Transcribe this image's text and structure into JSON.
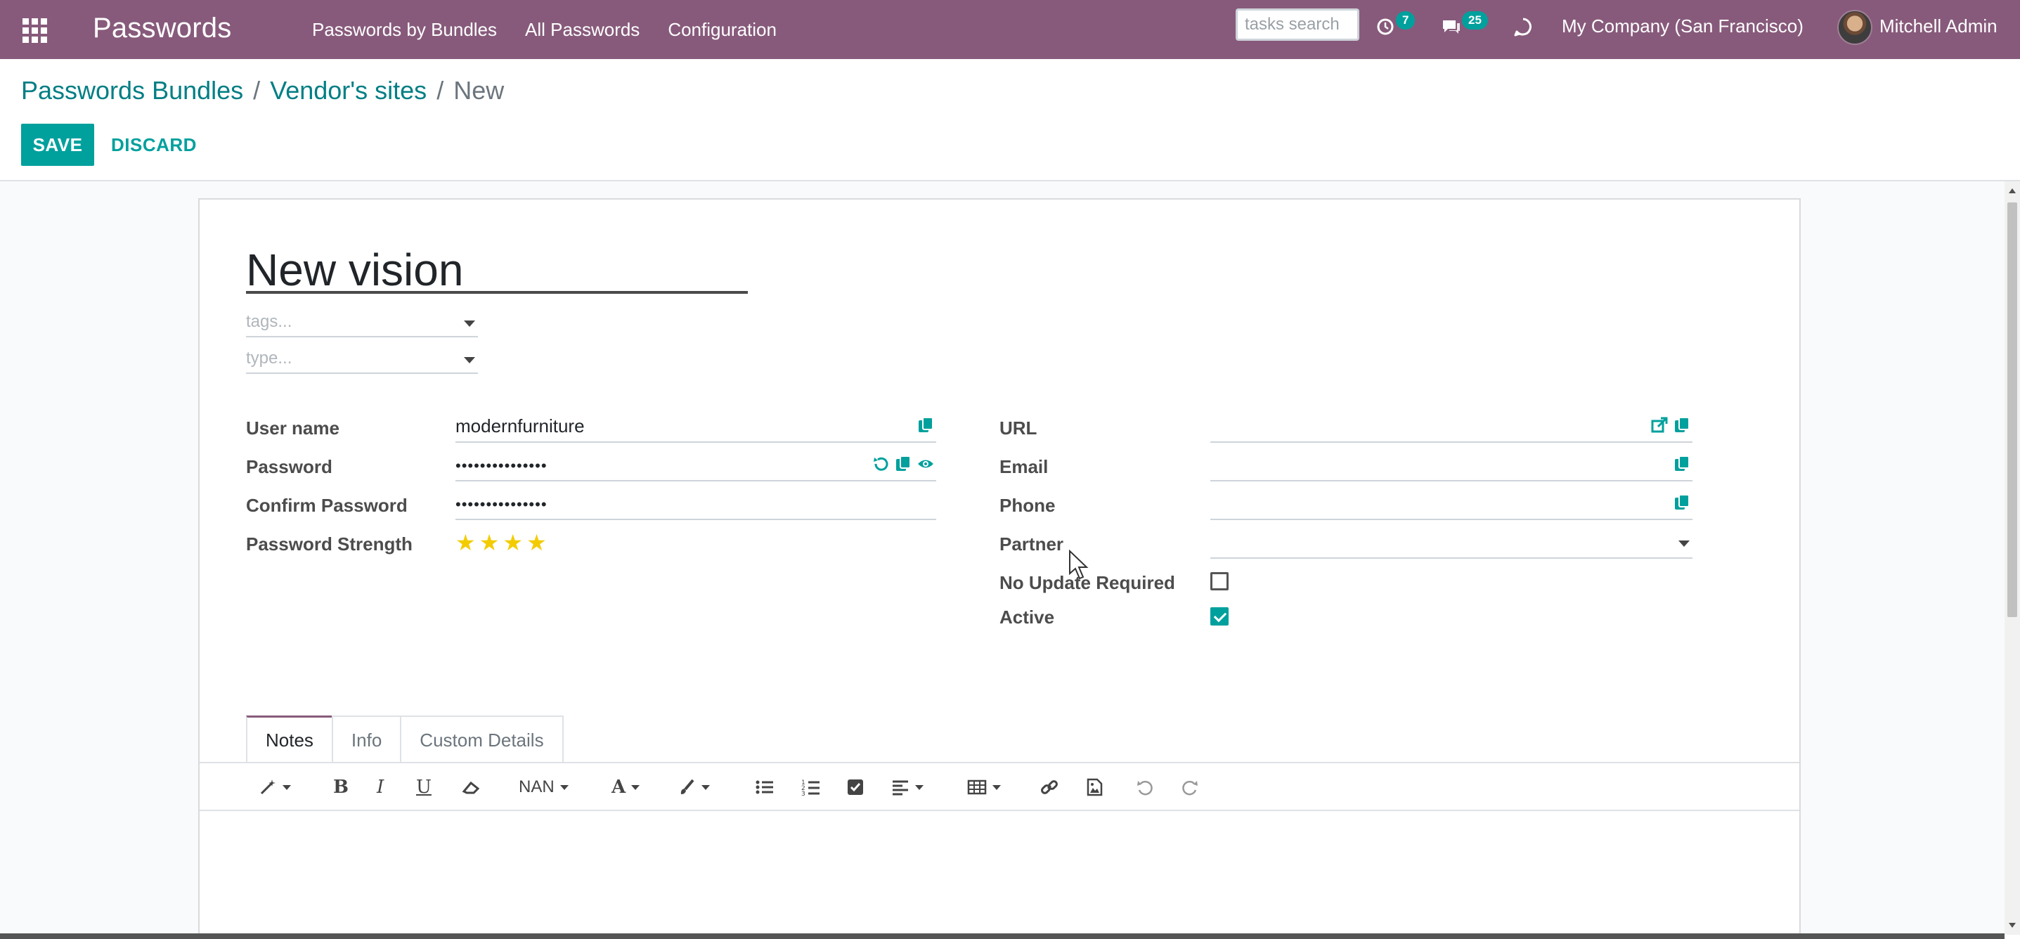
{
  "navbar": {
    "app_name": "Passwords",
    "menu": [
      {
        "label": "Passwords by Bundles"
      },
      {
        "label": "All Passwords"
      },
      {
        "label": "Configuration"
      }
    ],
    "search_placeholder": "tasks search",
    "activity_count": "7",
    "messages_count": "25",
    "company": "My Company (San Francisco)",
    "user": "Mitchell Admin",
    "color": "#875a7b"
  },
  "breadcrumb": {
    "items": [
      "Passwords Bundles",
      "Vendor's sites"
    ],
    "current": "New"
  },
  "buttons": {
    "save": "SAVE",
    "discard": "DISCARD"
  },
  "form": {
    "name": "New vision",
    "tags_placeholder": "tags...",
    "type_placeholder": "type...",
    "left": {
      "user_name_label": "User name",
      "user_name_value": "modernfurniture",
      "password_label": "Password",
      "password_value": "•••••••••••••••",
      "confirm_label": "Confirm Password",
      "confirm_value": "•••••••••••••••",
      "strength_label": "Password Strength",
      "strength_stars": 4
    },
    "right": {
      "url_label": "URL",
      "url_value": "",
      "email_label": "Email",
      "email_value": "",
      "phone_label": "Phone",
      "phone_value": "",
      "partner_label": "Partner",
      "partner_value": "",
      "no_update_label": "No Update Required",
      "no_update_checked": false,
      "active_label": "Active",
      "active_checked": true
    }
  },
  "tabs": [
    {
      "label": "Notes",
      "active": true
    },
    {
      "label": "Info",
      "active": false
    },
    {
      "label": "Custom Details",
      "active": false
    }
  ],
  "editor_toolbar": {
    "font_size_label": "NAN"
  },
  "colors": {
    "accent": "#00a09d",
    "link": "#017e84",
    "star": "#f3cc00"
  }
}
